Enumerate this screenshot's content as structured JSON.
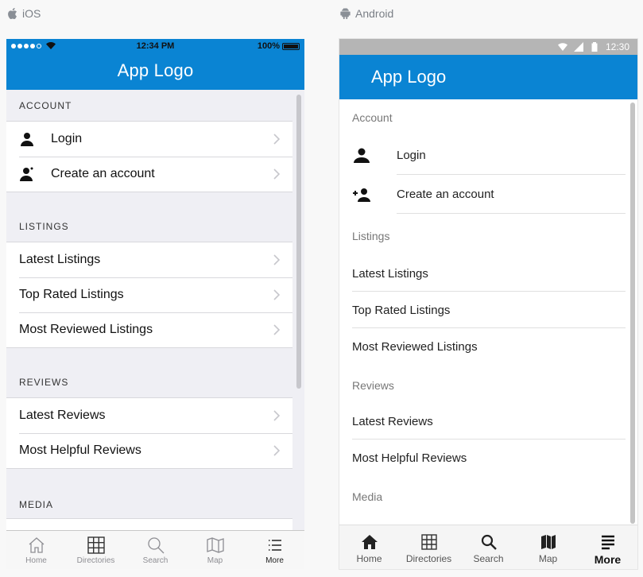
{
  "ios_label": "iOS",
  "android_label": "Android",
  "ios": {
    "status": {
      "time": "12:34 PM",
      "battery": "100%"
    },
    "nav_title": "App Logo",
    "sections": [
      {
        "header": "ACCOUNT",
        "items": [
          {
            "label": "Login",
            "icon": "person-icon"
          },
          {
            "label": "Create an account",
            "icon": "person-add-icon"
          }
        ]
      },
      {
        "header": "LISTINGS",
        "items": [
          {
            "label": "Latest Listings"
          },
          {
            "label": "Top Rated Listings"
          },
          {
            "label": "Most Reviewed Listings"
          }
        ]
      },
      {
        "header": "REVIEWS",
        "items": [
          {
            "label": "Latest Reviews"
          },
          {
            "label": "Most Helpful Reviews"
          }
        ]
      },
      {
        "header": "MEDIA",
        "items": []
      }
    ],
    "tabs": [
      {
        "label": "Home",
        "icon": "home-icon"
      },
      {
        "label": "Directories",
        "icon": "grid-icon"
      },
      {
        "label": "Search",
        "icon": "search-icon"
      },
      {
        "label": "Map",
        "icon": "map-icon"
      },
      {
        "label": "More",
        "icon": "menu-icon",
        "active": true
      }
    ]
  },
  "android": {
    "status": {
      "time": "12:30"
    },
    "toolbar_title": "App Logo",
    "sections": [
      {
        "header": "Account",
        "items": [
          {
            "label": "Login",
            "icon": "person-icon"
          },
          {
            "label": "Create an account",
            "icon": "person-add-icon"
          }
        ]
      },
      {
        "header": "Listings",
        "items": [
          {
            "label": "Latest Listings"
          },
          {
            "label": "Top Rated Listings"
          },
          {
            "label": "Most Reviewed Listings"
          }
        ]
      },
      {
        "header": "Reviews",
        "items": [
          {
            "label": "Latest Reviews"
          },
          {
            "label": "Most Helpful Reviews"
          }
        ]
      },
      {
        "header": "Media",
        "items": []
      }
    ],
    "tabs": [
      {
        "label": "Home",
        "icon": "home-icon"
      },
      {
        "label": "Directories",
        "icon": "grid-icon"
      },
      {
        "label": "Search",
        "icon": "search-icon"
      },
      {
        "label": "Map",
        "icon": "map-icon"
      },
      {
        "label": "More",
        "icon": "menu-icon",
        "active": true
      }
    ]
  },
  "colors": {
    "brand": "#0a84d3",
    "ios_status": "#0a84d3",
    "android_status": "#b5b5b5"
  }
}
